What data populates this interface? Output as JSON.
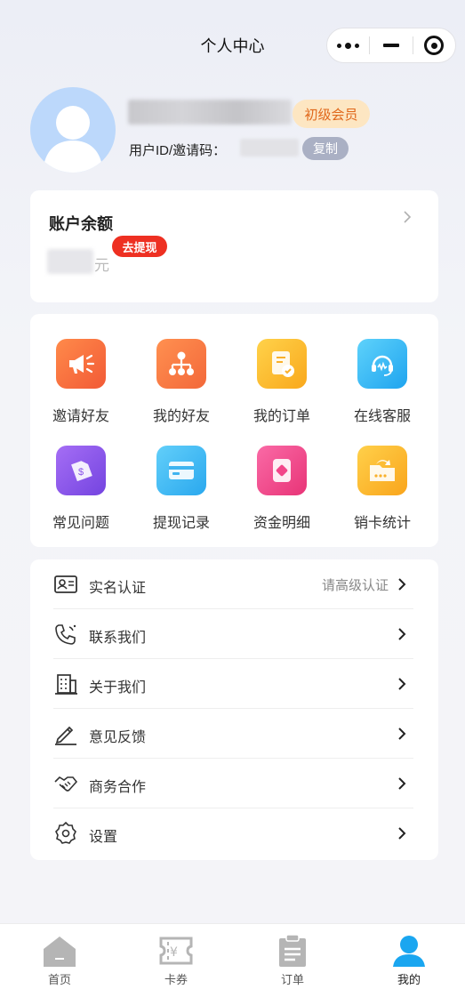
{
  "header": {
    "title": "个人中心"
  },
  "profile": {
    "level_badge": "初级会员",
    "uid_label": "用户ID/邀请码：",
    "copy_label": "复制"
  },
  "balance": {
    "title": "账户余额",
    "unit": "元",
    "withdraw_label": "去提现"
  },
  "grid": [
    {
      "label": "邀请好友",
      "icon": "megaphone-icon",
      "color": "#f4663a"
    },
    {
      "label": "我的好友",
      "icon": "org-tree-icon",
      "color": "#f7773e"
    },
    {
      "label": "我的订单",
      "icon": "order-doc-icon",
      "color": "#fcba2c"
    },
    {
      "label": "在线客服",
      "icon": "headset-icon",
      "color": "#36b8f2"
    },
    {
      "label": "常见问题",
      "icon": "question-tag-icon",
      "color": "#8a53e8"
    },
    {
      "label": "提现记录",
      "icon": "card-icon",
      "color": "#3fb4f0"
    },
    {
      "label": "资金明细",
      "icon": "wallet-icon",
      "color": "#f2468a"
    },
    {
      "label": "销卡统计",
      "icon": "folder-icon",
      "color": "#fcb32c"
    }
  ],
  "list": [
    {
      "label": "实名认证",
      "right": "请高级认证",
      "icon": "id-card-icon"
    },
    {
      "label": "联系我们",
      "right": "",
      "icon": "phone-icon"
    },
    {
      "label": "关于我们",
      "right": "",
      "icon": "building-icon"
    },
    {
      "label": "意见反馈",
      "right": "",
      "icon": "pen-icon"
    },
    {
      "label": "商务合作",
      "right": "",
      "icon": "handshake-icon"
    },
    {
      "label": "设置",
      "right": "",
      "icon": "settings-icon"
    }
  ],
  "tabs": [
    {
      "label": "首页",
      "icon": "home-icon"
    },
    {
      "label": "卡券",
      "icon": "ticket-icon"
    },
    {
      "label": "订单",
      "icon": "clipboard-icon"
    },
    {
      "label": "我的",
      "icon": "user-icon",
      "active": true
    }
  ],
  "colors": {
    "accent": "#1aa6f0",
    "badge_red": "#ee3022",
    "level_badge_text": "#e0671a"
  }
}
